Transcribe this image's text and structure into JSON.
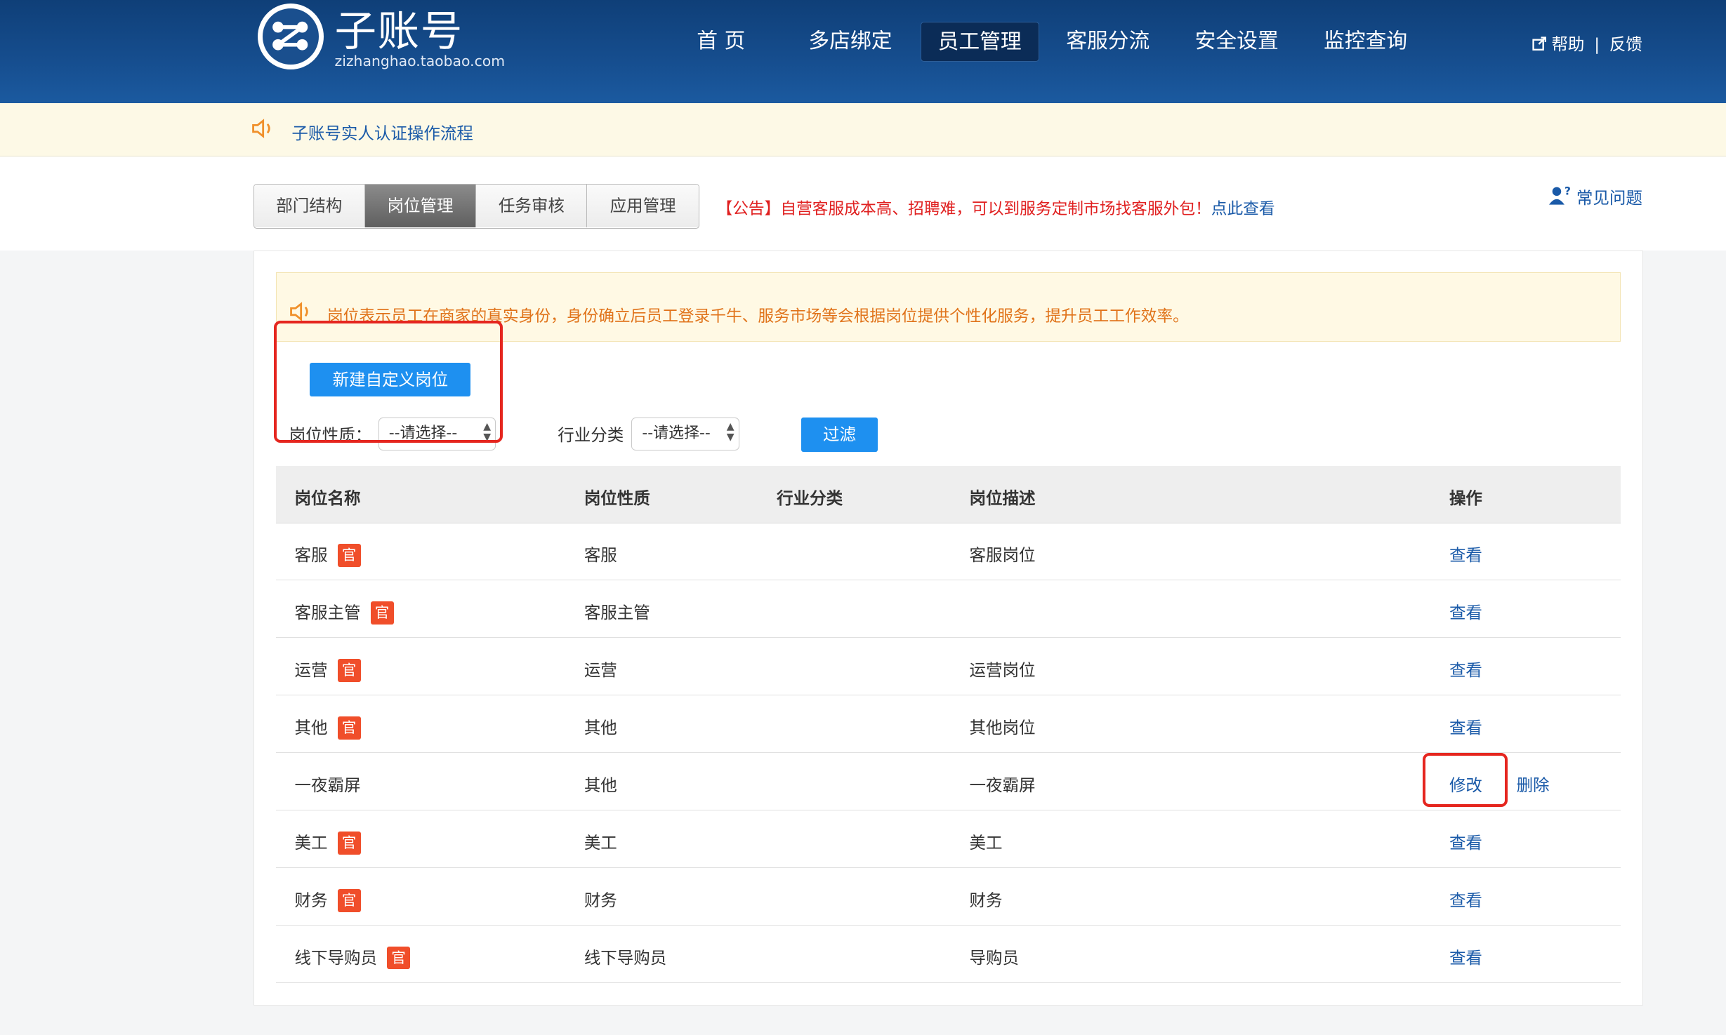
{
  "header": {
    "logo_title": "子账号",
    "logo_sub": "zizhanghao.taobao.com",
    "nav": [
      "首 页",
      "多店绑定",
      "员工管理",
      "客服分流",
      "安全设置",
      "监控查询"
    ],
    "active_nav": "员工管理",
    "help": "帮助",
    "feedback": "反馈"
  },
  "notice": {
    "text": "子账号实人认证操作流程"
  },
  "tabs": {
    "items": [
      "部门结构",
      "岗位管理",
      "任务审核",
      "应用管理"
    ],
    "active": "岗位管理"
  },
  "announcement": {
    "text": "【公告】自营客服成本高、招聘难，可以到服务定制市场找客服外包！",
    "link": "点此查看"
  },
  "faq": "常见问题",
  "tip": "岗位表示员工在商家的真实身份，身份确立后员工登录千牛、服务市场等会根据岗位提供个性化服务，提升员工工作效率。",
  "toolbar": {
    "new_button": "新建自定义岗位",
    "nature_label": "岗位性质：",
    "nature_value": "--请选择--",
    "industry_label": "行业分类",
    "industry_value": "--请选择--",
    "filter_button": "过滤"
  },
  "table": {
    "headers": [
      "岗位名称",
      "岗位性质",
      "行业分类",
      "岗位描述",
      "操作"
    ],
    "badge": "官",
    "rows": [
      {
        "name": "客服",
        "nature": "客服",
        "industry": "",
        "desc": "客服岗位",
        "official": true,
        "actions": [
          "查看"
        ]
      },
      {
        "name": "客服主管",
        "nature": "客服主管",
        "industry": "",
        "desc": "",
        "official": true,
        "actions": [
          "查看"
        ]
      },
      {
        "name": "运营",
        "nature": "运营",
        "industry": "",
        "desc": "运营岗位",
        "official": true,
        "actions": [
          "查看"
        ]
      },
      {
        "name": "其他",
        "nature": "其他",
        "industry": "",
        "desc": "其他岗位",
        "official": true,
        "actions": [
          "查看"
        ]
      },
      {
        "name": "一夜霸屏",
        "nature": "其他",
        "industry": "",
        "desc": "一夜霸屏",
        "official": false,
        "actions": [
          "修改",
          "删除"
        ]
      },
      {
        "name": "美工",
        "nature": "美工",
        "industry": "",
        "desc": "美工",
        "official": true,
        "actions": [
          "查看"
        ]
      },
      {
        "name": "财务",
        "nature": "财务",
        "industry": "",
        "desc": "财务",
        "official": true,
        "actions": [
          "查看"
        ]
      },
      {
        "name": "线下导购员",
        "nature": "线下导购员",
        "industry": "",
        "desc": "导购员",
        "official": true,
        "actions": [
          "查看"
        ]
      }
    ]
  },
  "colors": {
    "header_bg": "#164e8f",
    "primary_button": "#1e90f0",
    "link": "#1a5aa8",
    "badge": "#f04e2a",
    "highlight_box": "#e5261f",
    "announcement": "#e02020",
    "tip_text": "#e0731a"
  },
  "icons": {
    "logo": "share-network-icon",
    "help": "external-link-icon",
    "notice": "speaker-icon",
    "faq": "user-question-icon",
    "select_arrow": "updown-arrow-icon"
  }
}
